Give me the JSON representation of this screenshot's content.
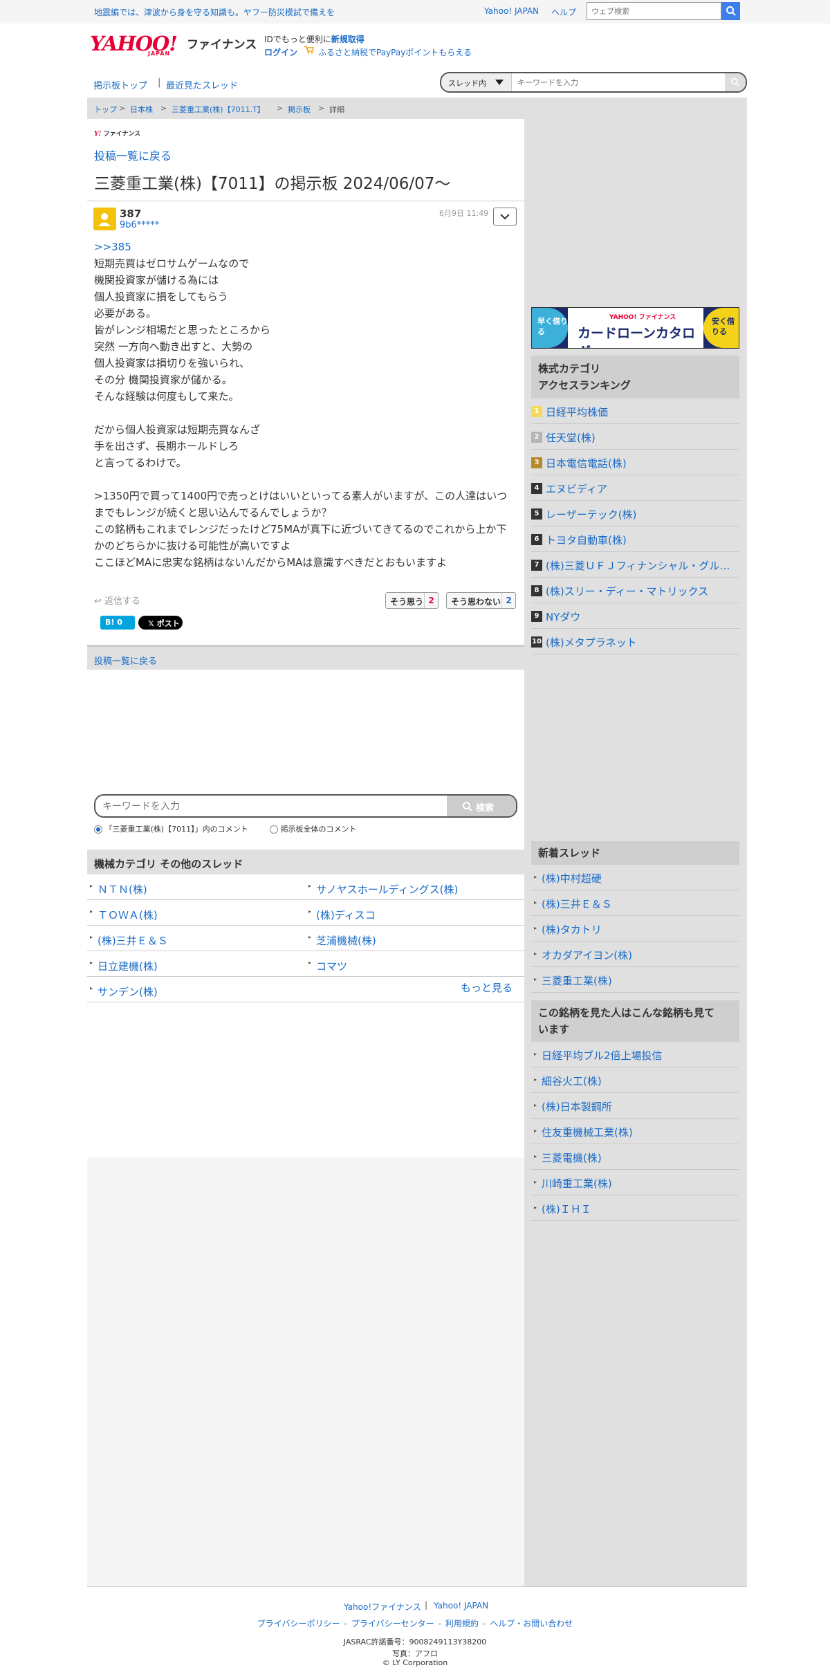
{
  "topbar": {
    "alert": "地震編では、津波から身を守る知識も。ヤフー防災模試で備えを",
    "yahoo_japan": "Yahoo! JAPAN",
    "help": "ヘルプ",
    "search_placeholder": "ウェブ検索"
  },
  "header": {
    "logo": "YAHOO!",
    "logo_sub": "JAPAN",
    "finance": "ファイナンス",
    "promo_prefix": "IDでもっと便利に",
    "promo_register": "新規取得",
    "login": "ログイン",
    "promo_link": "ふるさと納税でPayPayポイントもらえる"
  },
  "nav": {
    "board_top": "掲示板トップ",
    "separator": "|",
    "recent": "最近見たスレッド",
    "scope": "スレッド内",
    "search_placeholder": "キーワードを入力"
  },
  "breadcrumb": {
    "items": [
      "トップ",
      "日本株",
      "三菱重工業(株)【7011.T】",
      "掲示板",
      "詳細"
    ],
    "sep": ">"
  },
  "post": {
    "brand": "ファイナンス",
    "brand_y": "Y!",
    "back_link": "投稿一覧に戻る",
    "board_title": "三菱重工業(株)【7011】の掲示板 2024/06/07〜",
    "number": "387",
    "user": "9b6*****",
    "date": "6月9日 11:49",
    "reply_ref": ">>385",
    "lines": [
      "短期売買はゼロサムゲームなので",
      "機関投資家が儲ける為には",
      "個人投資家に損をしてもらう",
      "必要がある。",
      "皆がレンジ相場だと思ったところから",
      "突然 一方向へ動き出すと、大勢の",
      "個人投資家は損切りを強いられ、",
      "その分 機関投資家が儲かる。",
      "そんな経験は何度もして来た。",
      "",
      "だから個人投資家は短期売買なんざ",
      "手を出さず、長期ホールドしろ",
      "と言ってるわけで。",
      ""
    ],
    "para2": ">1350円で買って1400円で売っとけはいいといってる素人がいますが、この人達はいつまでもレンジが続くと思い込んでるんでしょうか？",
    "para3": "この銘柄もこれまでレンジだったけど75MAが真下に近づいてきてるのでこれから上か下かのどちらかに抜ける可能性が高いですよ",
    "para4": "ここほどMAに忠実な銘柄はないんだからMAは意識すべきだとおもいますよ",
    "reply": "返信する",
    "agree_label": "そう思う",
    "agree_count": "2",
    "disagree_label": "そう思わない",
    "disagree_count": "2",
    "hatena": "B! 0",
    "x_post": "𝕏 ポスト",
    "back_link_bottom": "投稿一覧に戻る"
  },
  "keyword_search": {
    "placeholder": "キーワードを入力",
    "button": "検索",
    "radio_thread": "「三菱重工業(株)【7011】」内のコメント",
    "radio_all": "掲示板全体のコメント"
  },
  "other_threads": {
    "title": "機械カテゴリ その他のスレッド",
    "items": [
      "ＮＴＮ(株)",
      "サノヤスホールディングス(株)",
      "ＴＯＷＡ(株)",
      "(株)ディスコ",
      "(株)三井Ｅ＆Ｓ",
      "芝浦機械(株)",
      "日立建機(株)",
      "コマツ",
      "サンデン(株)"
    ],
    "more": "もっと見る"
  },
  "ad": {
    "left": "早く借りる",
    "brand": "YAHOO! ファイナンス",
    "title": "カードローンカタログ",
    "right": "安く借りる"
  },
  "ranking": {
    "title_line1": "株式カテゴリ",
    "title_line2": "アクセスランキング",
    "items": [
      {
        "rank": "1",
        "name": "日経平均株価"
      },
      {
        "rank": "2",
        "name": "任天堂(株)"
      },
      {
        "rank": "3",
        "name": "日本電信電話(株)"
      },
      {
        "rank": "4",
        "name": "エヌビディア"
      },
      {
        "rank": "5",
        "name": "レーザーテック(株)"
      },
      {
        "rank": "6",
        "name": "トヨタ自動車(株)"
      },
      {
        "rank": "7",
        "name": "(株)三菱ＵＦＪフィナンシャル・グループ"
      },
      {
        "rank": "8",
        "name": "(株)スリー・ディー・マトリックス"
      },
      {
        "rank": "9",
        "name": "NYダウ"
      },
      {
        "rank": "10",
        "name": "(株)メタプラネット"
      }
    ],
    "colors": {
      "gold": "#f6d95a",
      "silver": "#b5b5b5",
      "bronze": "#b58b2a",
      "other": "#333333"
    }
  },
  "new_threads": {
    "title": "新着スレッド",
    "items": [
      "(株)中村超硬",
      "(株)三井Ｅ＆Ｓ",
      "(株)タカトリ",
      "オカダアイヨン(株)",
      "三菱重工業(株)"
    ]
  },
  "also_viewed": {
    "title_line1": "この銘柄を見た人はこんな銘柄も見て",
    "title_line2": "います",
    "items": [
      "日経平均ブル2倍上場投信",
      "細谷火工(株)",
      "(株)日本製鋼所",
      "住友重機械工業(株)",
      "三菱電機(株)",
      "川崎重工業(株)",
      "(株)ＩＨＩ"
    ]
  },
  "footer": {
    "finance": "Yahoo!ファイナンス",
    "sep": "|",
    "yahoo_japan": "Yahoo! JAPAN",
    "links": [
      "プライバシーポリシー",
      "プライバシーセンター",
      "利用規約",
      "ヘルプ・お問い合わせ"
    ],
    "link_sep": "-",
    "jasrac": "JASRAC許諾番号：9008249113Y38200",
    "photo": "写真：アフロ",
    "copyright": "© LY Corporation"
  },
  "colors": {
    "link": "#1a6bc7",
    "brand_red": "#e60033",
    "search_blue": "#3d7ee8"
  }
}
